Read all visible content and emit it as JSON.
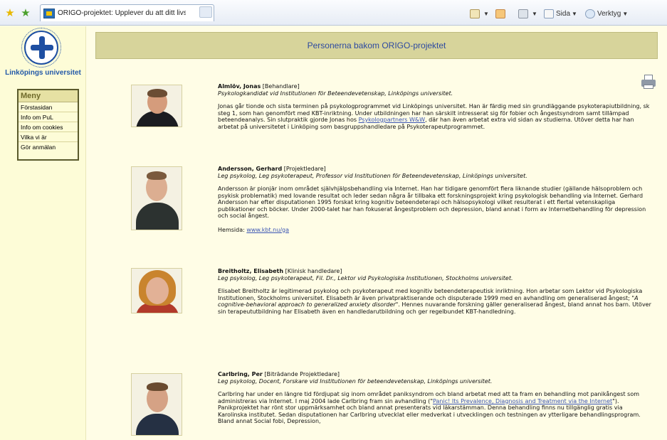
{
  "browser": {
    "tab_title": "ORIGO-projektet: Upplever du att ditt livs styrs av öv...",
    "commands": {
      "page_label": "Sida",
      "tools_label": "Verktyg"
    }
  },
  "sidebar": {
    "university": "Linköpings universitet",
    "menu_title": "Meny",
    "items": [
      {
        "label": "Förstasidan"
      },
      {
        "label": "Info om PuL"
      },
      {
        "label": "Info om cookies"
      },
      {
        "label": "Vilka vi är"
      },
      {
        "label": "Gör anmälan"
      }
    ]
  },
  "main": {
    "title": "Personerna bakom ORIGO-projektet"
  },
  "people": [
    {
      "name": "Almlöv, Jonas",
      "role": "[Behandlare]",
      "title": "Psykologkandidat vid Institutionen för Beteendevetenskap, Linköpings universitet.",
      "text_before": "Jonas går tionde och sista terminen på psykologprogrammet vid Linköpings universitet. Han är färdig med sin grundläggande psykoterapiutbildning, sk steg 1, som han genomfört med KBT-inriktning. Under utbildningen har han särskilt intresserat sig för fobier och ångestsyndrom samt tillämpad beteendeanalys. Sin slutpraktik gjorde Jonas hos ",
      "link": "Psykologpartners W&W",
      "text_after": ", där han även arbetat extra vid sidan av studierna. Utöver detta har han arbetat på universitetet i Linköping som basgruppshandledare på Psykoterapeutprogrammet."
    },
    {
      "name": "Andersson, Gerhard",
      "role": "[Projektledare]",
      "title": "Leg psykolog, Leg psykoterapeut, Professor vid Institutionen för Beteendevetenskap, Linköpings universitet.",
      "text": "Andersson är pionjär inom området självhjälpsbehandling via Internet. Han har tidigare genomfört flera liknande studier (gällande hälsoproblem och psykisk problematik) med lovande resultat och leder sedan några år tillbaka ett forskningsprojekt kring psykologisk behandling via Internet. Gerhard Andersson har efter disputationen 1995 forskat kring kognitiv beteendeterapi och hälsopsykologi vilket resulterat i ett flertal vetenskapliga publikationer och böcker. Under 2000-talet har han fokuserat ångestproblem och depression, bland annat i form av Internetbehandling för depression och social ångest.",
      "homepage_label": "Hemsida:",
      "homepage_link": "www.kbt.nu/ga"
    },
    {
      "name": "Breitholtz, Elisabeth",
      "role": "[Klinisk handledare]",
      "title": "Leg psykolog, Leg psykoterapeut, Fil. Dr., Lektor vid Psykologiska Institutionen, Stockholms universitet.",
      "text_before": "Elisabet Breitholtz är legitimerad psykolog och psykoterapeut med kognitiv beteendeterapeutisk inriktning. Hon arbetar som Lektor vid Psykologiska Institutionen, Stockholms universitet. Elisabeth är även privatpraktiserande och disputerade 1999 med en avhandling om generaliserad ångest; ",
      "italic": "\"A cognitive-behavioral approach to generalized anxiety disorder\"",
      "text_after": ". Hennes nuvarande forskning gäller generaliserad ångest, bland annat hos barn. Utöver sin terapeututbildning har Elisabeth även en handledarutbildning och ger regelbundet KBT-handledning."
    },
    {
      "name": "Carlbring, Per",
      "role": "[Biträdande Projektledare]",
      "title": "Leg psykolog, Docent, Forskare vid Institutionen för beteendevetenskap, Linköpings universitet.",
      "text_before": "Carlbring har under en längre tid fördjupat sig inom området paniksyndrom och bland arbetat med att ta fram en behandling mot panikångest som administreras via Internet. I maj 2004 lade Carlbring fram sin avhandling (\"",
      "link": "Panic! Its Prevalence, Diagnosis and Treatment via the Internet",
      "text_after": "\"). Panikprojektet har rönt stor uppmärksamhet och bland annat presenterats vid läkarstämman. Denna behandling finns nu tillgänglig gratis via Karolinska institutet. Sedan disputationen har Carlbring utvecklat eller medverkat i utvecklingen och testningen av ytterligare behandlingsprogram. Bland annat Social fobi, Depression,"
    }
  ],
  "colors": {
    "background": "#fffde6",
    "sidebar": "#fdfcd7",
    "header_band": "#d7d49b",
    "title_blue": "#2d4aa0",
    "link_blue": "#3b55b3"
  },
  "icons": [
    "favorites-star-icon",
    "add-favorite-icon",
    "home-icon",
    "rss-icon",
    "print-icon",
    "page-icon",
    "tools-icon",
    "university-logo-icon",
    "printer-icon"
  ]
}
